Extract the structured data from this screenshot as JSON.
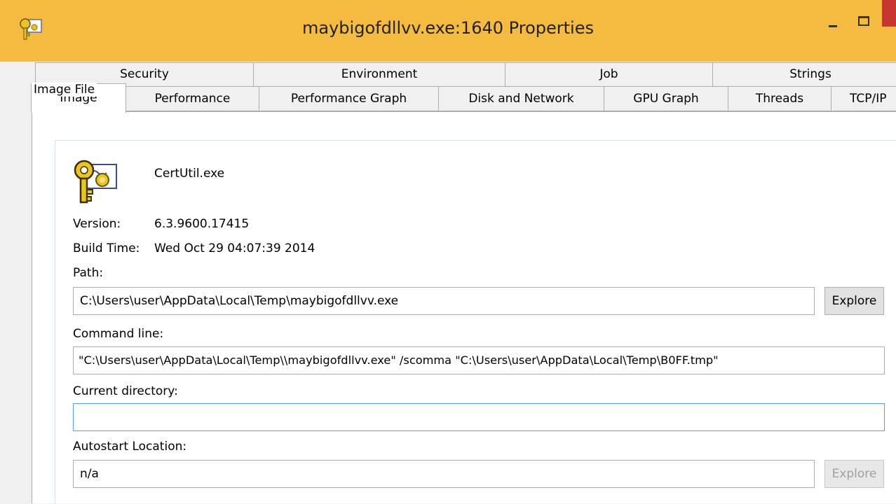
{
  "window": {
    "title": "maybigofdllvv.exe:1640 Properties"
  },
  "icons": {
    "title_icon": "certificate-key-icon",
    "app_icon": "certificate-key-icon"
  },
  "tabs": {
    "row1": [
      "Security",
      "Environment",
      "Job",
      "Strings"
    ],
    "row2": [
      "Image",
      "Performance",
      "Performance Graph",
      "Disk and Network",
      "GPU Graph",
      "Threads",
      "TCP/IP"
    ],
    "active": "Image"
  },
  "image_file": {
    "group_label": "Image File",
    "file_name": "CertUtil.exe",
    "version_label": "Version:",
    "version_value": "6.3.9600.17415",
    "build_label": "Build Time:",
    "build_value": "Wed Oct 29 04:07:39 2014",
    "path_label": "Path:",
    "path_value": "C:\\Users\\user\\AppData\\Local\\Temp\\maybigofdllvv.exe",
    "explore_label": "Explore",
    "cmd_label": "Command line:",
    "cmd_value": "\"C:\\Users\\user\\AppData\\Local\\Temp\\\\maybigofdllvv.exe\" /scomma \"C:\\Users\\user\\AppData\\Local\\Temp\\B0FF.tmp\"",
    "curdir_label": "Current directory:",
    "curdir_value": "",
    "autostart_label": "Autostart Location:",
    "autostart_value": "n/a",
    "autostart_explore_label": "Explore"
  },
  "colors": {
    "titlebar": "#f5ba40",
    "close_button": "#c7372f",
    "focus_border": "#569de5"
  }
}
